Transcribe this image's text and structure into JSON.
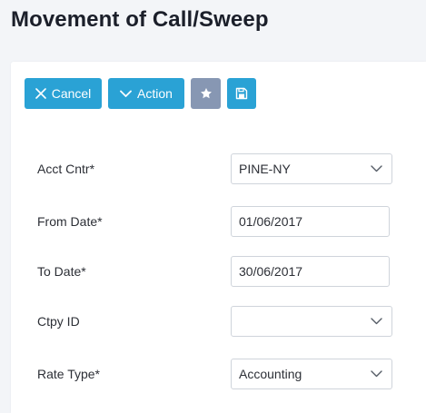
{
  "page": {
    "title": "Movement of Call/Sweep"
  },
  "toolbar": {
    "cancel_label": "Cancel",
    "action_label": "Action",
    "favorite_icon": "star-icon",
    "save_icon": "save-icon"
  },
  "form": {
    "acct_cntr": {
      "label": "Acct Cntr*",
      "value": "PINE-NY"
    },
    "from_date": {
      "label": "From Date*",
      "value": "01/06/2017"
    },
    "to_date": {
      "label": "To Date*",
      "value": "30/06/2017"
    },
    "ctpy_id": {
      "label": "Ctpy ID",
      "value": ""
    },
    "rate_type": {
      "label": "Rate Type*",
      "value": "Accounting"
    }
  },
  "colors": {
    "primary_button": "#2aa2d5",
    "secondary_button": "#8797b3",
    "background": "#f3f5f8",
    "panel": "#ffffff"
  }
}
